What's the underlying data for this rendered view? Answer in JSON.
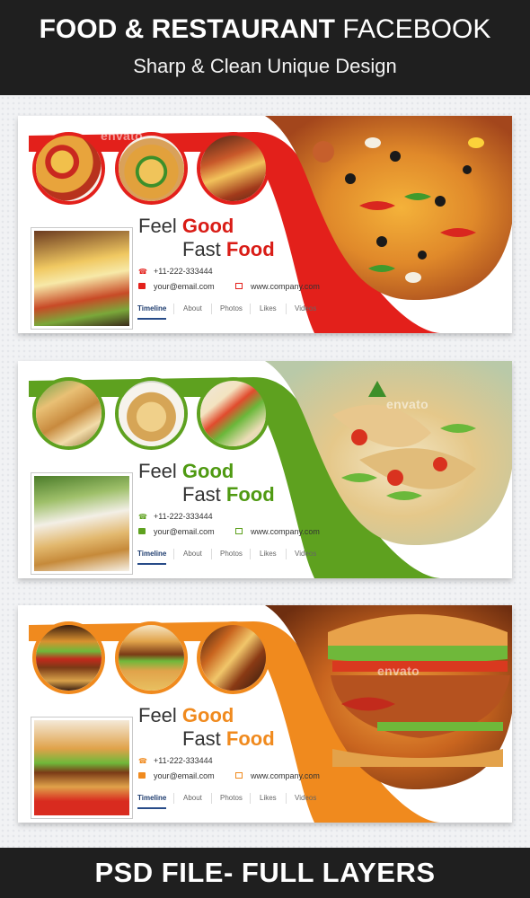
{
  "header": {
    "title_bold": "FOOD & RESTAURANT",
    "title_light": "FACEBOOK",
    "subtitle": "Sharp & Clean Unique Design"
  },
  "footer": {
    "text": "PSD FILE- FULL LAYERS"
  },
  "watermark": "envato",
  "cards": [
    {
      "theme": "red",
      "accent": "#e3201b",
      "accent_text": "#d91c16",
      "tagline_1a": "Feel",
      "tagline_1b": "Good",
      "tagline_2a": "Fast",
      "tagline_2b": "Food",
      "phone": "+11-222-333444",
      "email": "your@email.com",
      "website": "www.company.com",
      "nav": [
        "Timeline",
        "About",
        "Photos",
        "Likes",
        "Videos"
      ],
      "photos": [
        "pizza slices",
        "pizza with peppers",
        "pizza cheese pull",
        "sliced pizza"
      ]
    },
    {
      "theme": "green",
      "accent": "#5ea11f",
      "accent_text": "#4f9a12",
      "tagline_1a": "Feel",
      "tagline_1b": "Good",
      "tagline_2a": "Fast",
      "tagline_2b": "Food",
      "phone": "+11-222-333444",
      "email": "your@email.com",
      "website": "www.company.com",
      "nav": [
        "Timeline",
        "About",
        "Photos",
        "Likes",
        "Videos"
      ],
      "photos": [
        "spring rolls",
        "spring rolls plate",
        "veggie wrap",
        "wraps"
      ]
    },
    {
      "theme": "orange",
      "accent": "#f08a1e",
      "accent_text": "#f08a1e",
      "tagline_1a": "Feel",
      "tagline_1b": "Good",
      "tagline_2a": "Fast",
      "tagline_2b": "Food",
      "phone": "+11-222-333444",
      "email": "your@email.com",
      "website": "www.company.com",
      "nav": [
        "Timeline",
        "About",
        "Photos",
        "Likes",
        "Videos"
      ],
      "photos": [
        "burger",
        "burger with fries",
        "gyro",
        "burger close-up"
      ]
    }
  ]
}
